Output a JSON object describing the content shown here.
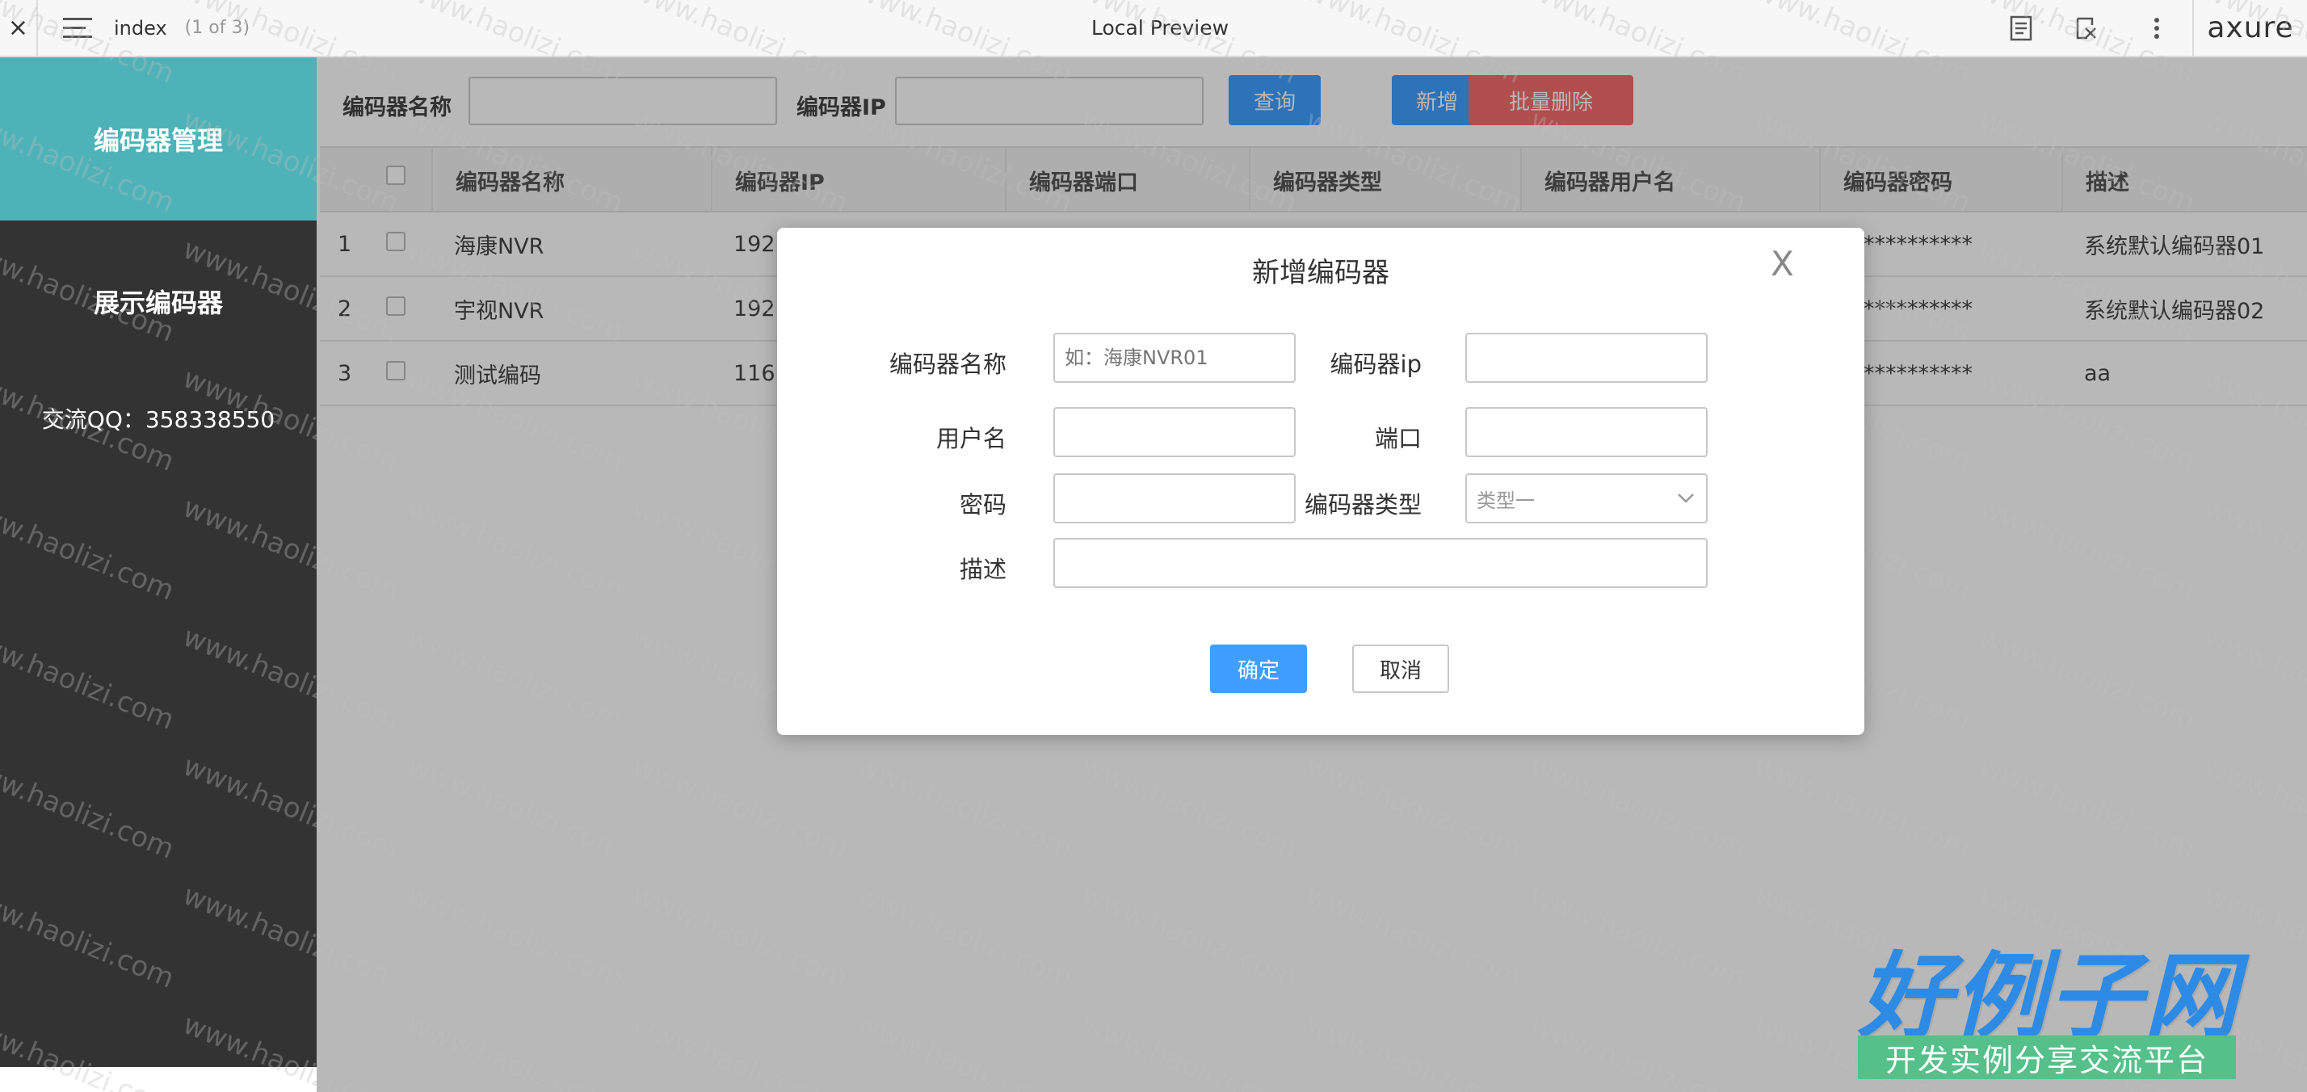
{
  "toolbar": {
    "close_glyph": "×",
    "page_name": "index",
    "page_count": "(1 of 3)",
    "title": "Local Preview",
    "brand": "axure",
    "icons": [
      "notes-icon",
      "adaptive-view-icon",
      "more-icon"
    ]
  },
  "sidebar": {
    "items": [
      {
        "label": "编码器管理",
        "active": true
      },
      {
        "label": "展示编码器",
        "active": false
      }
    ],
    "contact": "交流QQ：358338550",
    "active_color": "#4eb3b8",
    "bg_color": "#333333"
  },
  "search": {
    "name_label": "编码器名称",
    "ip_label": "编码器IP",
    "query_button": "查询",
    "add_button": "新增",
    "batch_delete_button": "批量删除"
  },
  "table": {
    "columns": [
      "编码器名称",
      "编码器IP",
      "编码器端口",
      "编码器类型",
      "编码器用户名",
      "编码器密码",
      "描述"
    ],
    "rows": [
      {
        "num": "1",
        "name": "海康NVR",
        "ip": "192.",
        "password": "************",
        "desc": "系统默认编码器01"
      },
      {
        "num": "2",
        "name": "宇视NVR",
        "ip": "192.",
        "password": "************",
        "desc": "系统默认编码器02"
      },
      {
        "num": "3",
        "name": "测试编码",
        "ip": "116",
        "password": "************",
        "desc": "aa"
      }
    ]
  },
  "modal": {
    "title": "新增编码器",
    "close_glyph": "X",
    "fields": {
      "name_label": "编码器名称",
      "name_placeholder": "如：海康NVR01",
      "ip_label": "编码器ip",
      "user_label": "用户名",
      "port_label": "端口",
      "password_label": "密码",
      "type_label": "编码器类型",
      "type_value": "类型一",
      "desc_label": "描述"
    },
    "ok_button": "确定",
    "cancel_button": "取消"
  },
  "watermark": {
    "text": "www.haolizi.com",
    "logo": "好例子网",
    "logo_sub": "开发实例分享交流平台"
  }
}
